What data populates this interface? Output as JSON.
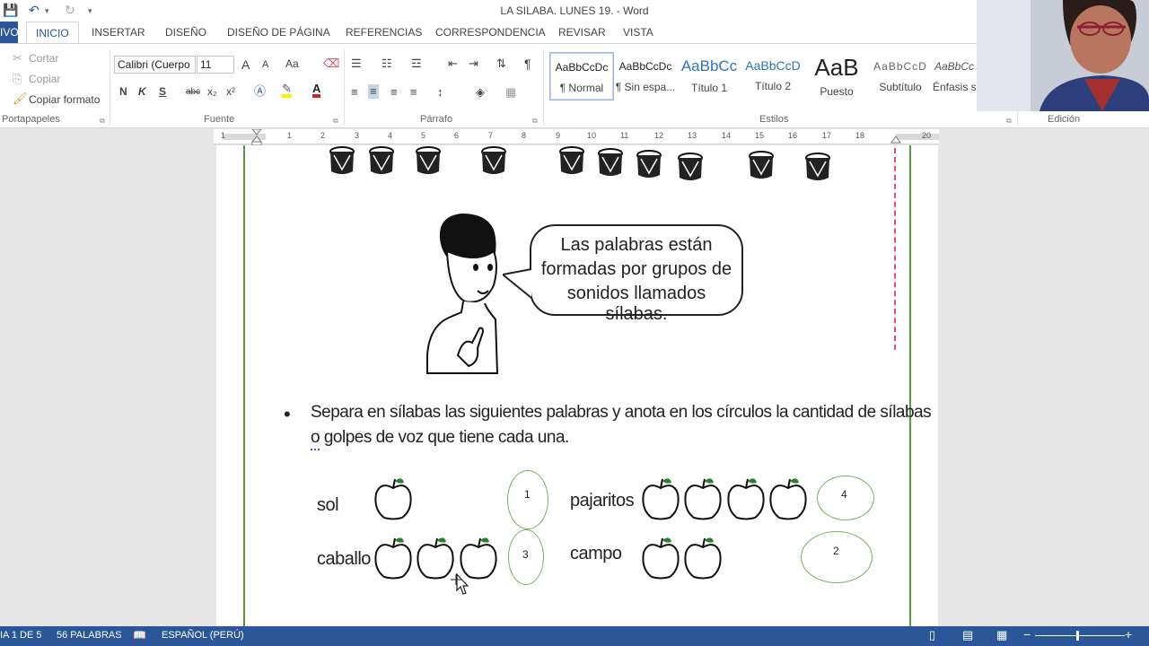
{
  "window": {
    "title": "LA SILABA. LUNES 19. - Word"
  },
  "quick_access": {
    "save_icon": "💾",
    "undo_icon": "↶",
    "redo_icon": "↻",
    "more_icon": "▾"
  },
  "tabs": {
    "archivo": "IVO",
    "items": [
      "INICIO",
      "INSERTAR",
      "DISEÑO",
      "DISEÑO DE PÁGINA",
      "REFERENCIAS",
      "CORRESPONDENCIA",
      "REVISAR",
      "VISTA"
    ]
  },
  "ribbon": {
    "clipboard": {
      "cut": "Cortar",
      "copy": "Copiar",
      "format_painter": "Copiar formato",
      "group": "Portapapeles"
    },
    "font": {
      "name": "Calibri (Cuerpo",
      "size": "11",
      "bold": "N",
      "italic": "K",
      "underline": "S",
      "strike": "abc",
      "sub": "x₂",
      "sup": "x²",
      "case": "Aa",
      "grow": "A",
      "shrink": "A",
      "group": "Fuente"
    },
    "paragraph": {
      "group": "Párrafo",
      "pilcrow": "¶"
    },
    "styles": {
      "group": "Estilos",
      "items": [
        {
          "preview": "AaBbCcDc",
          "name": "¶ Normal"
        },
        {
          "preview": "AaBbCcDc",
          "name": "¶ Sin espa..."
        },
        {
          "preview": "AaBbCc",
          "name": "Título 1"
        },
        {
          "preview": "AaBbCcD",
          "name": "Título 2"
        },
        {
          "preview": "AaB",
          "name": "Puesto"
        },
        {
          "preview": "AaBbCcD",
          "name": "Subtítulo"
        },
        {
          "preview": "AaBbCc",
          "name": "Énfasis s"
        }
      ]
    },
    "editing": {
      "group": "Edición"
    }
  },
  "ruler": {
    "numbers": [
      "1",
      "1",
      "2",
      "3",
      "4",
      "5",
      "6",
      "7",
      "8",
      "9",
      "10",
      "11",
      "12",
      "13",
      "14",
      "15",
      "16",
      "17",
      "18",
      "20"
    ]
  },
  "document": {
    "bubble_lines": [
      "Las palabras están",
      "formadas por grupos de",
      "sonidos llamados sílabas."
    ],
    "bullet": "•",
    "instruction_line1": "Separa en sílabas las siguientes palabras y anota en los círculos la cantidad de sílabas",
    "instruction_line2": "o golpes de voz que tiene cada una.",
    "words": [
      {
        "word": "sol",
        "count": "1"
      },
      {
        "word": "pajaritos",
        "count": "4"
      },
      {
        "word": "caballo",
        "count": "3"
      },
      {
        "word": "campo",
        "count": "2"
      }
    ]
  },
  "status_bar": {
    "page": "IA 1 DE 5",
    "words": "56 PALABRAS",
    "language": "ESPAÑOL (PERÚ)"
  },
  "colors": {
    "accent": "#2b579a",
    "page_border": "#5a9a3f",
    "oval": "#7ab05c"
  }
}
